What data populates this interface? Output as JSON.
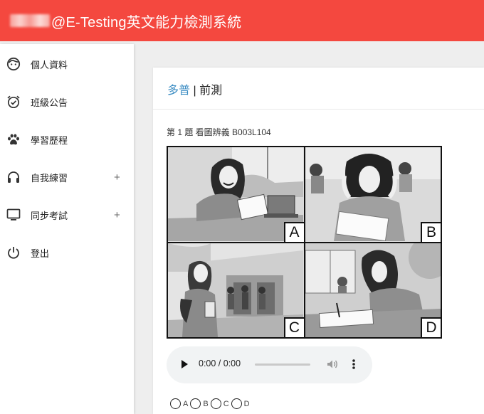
{
  "header": {
    "title": "@E-Testing英文能力檢測系統"
  },
  "sidebar": {
    "items": [
      {
        "label": "個人資料",
        "icon": "face-icon",
        "has_plus": false
      },
      {
        "label": "班級公告",
        "icon": "alarm-check-icon",
        "has_plus": false
      },
      {
        "label": "學習歷程",
        "icon": "paw-icon",
        "has_plus": false
      },
      {
        "label": "自我練習",
        "icon": "headphones-icon",
        "has_plus": true
      },
      {
        "label": "同步考試",
        "icon": "monitor-icon",
        "has_plus": true
      },
      {
        "label": "登出",
        "icon": "power-icon",
        "has_plus": false
      }
    ],
    "plus_symbol": "+"
  },
  "main": {
    "breadcrumb": {
      "link": "多普",
      "separator": "|",
      "current": "前測"
    },
    "question": {
      "title": "第 1 題 看圖辨義 B003L104",
      "panels": [
        "A",
        "B",
        "C",
        "D"
      ]
    },
    "audio": {
      "time": "0:00 / 0:00",
      "progress": 0
    },
    "options": [
      "A",
      "B",
      "C",
      "D"
    ]
  },
  "colors": {
    "header_bg": "#f4483f",
    "link": "#3c8dc3",
    "page_bg": "#eeeeee"
  }
}
